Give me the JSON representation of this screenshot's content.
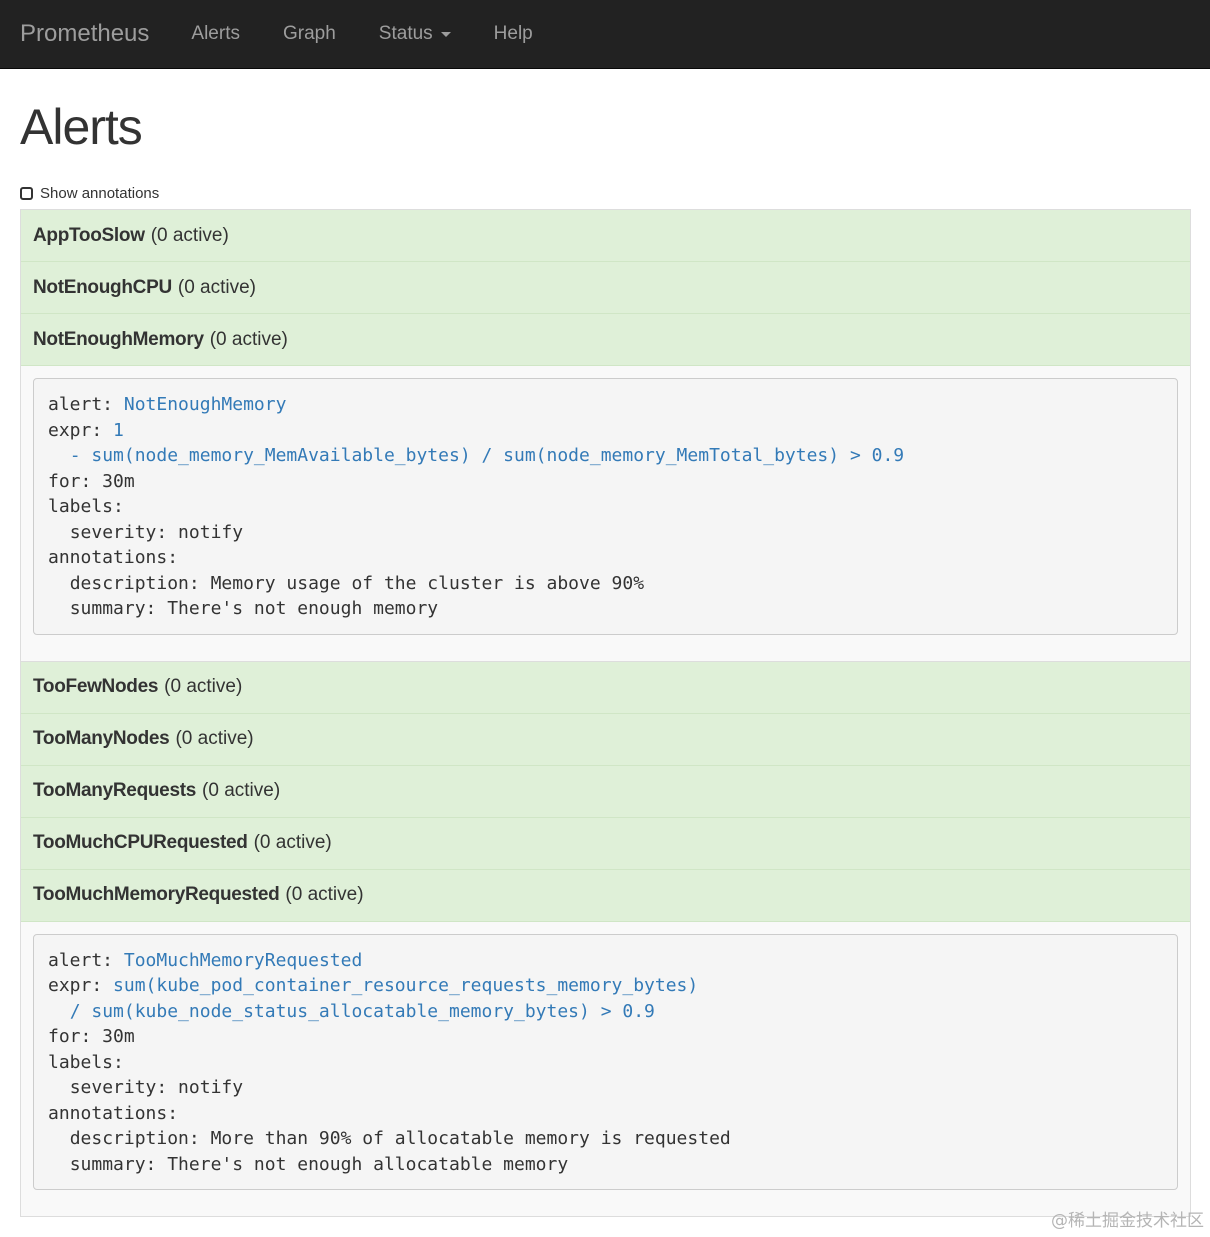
{
  "navbar": {
    "brand": "Prometheus",
    "items": [
      "Alerts",
      "Graph",
      "Status",
      "Help"
    ]
  },
  "page": {
    "title": "Alerts",
    "show_annotations_label": "Show annotations"
  },
  "alerts": [
    {
      "name": "AppTooSlow",
      "status": "(0 active)"
    },
    {
      "name": "NotEnoughCPU",
      "status": "(0 active)"
    },
    {
      "name": "NotEnoughMemory",
      "status": "(0 active)"
    },
    {
      "name": "TooFewNodes",
      "status": "(0 active)"
    },
    {
      "name": "TooManyNodes",
      "status": "(0 active)"
    },
    {
      "name": "TooManyRequests",
      "status": "(0 active)"
    },
    {
      "name": "TooMuchCPURequested",
      "status": "(0 active)"
    },
    {
      "name": "TooMuchMemoryRequested",
      "status": "(0 active)"
    }
  ],
  "rules": {
    "memory": {
      "alert_key": "alert:",
      "alert_value": "NotEnoughMemory",
      "expr_key": "expr:",
      "expr_line1": "1",
      "expr_line2": "- sum(node_memory_MemAvailable_bytes) / sum(node_memory_MemTotal_bytes) > 0.9",
      "for_line": "for: 30m",
      "labels_line": "labels:",
      "severity_line": "severity: notify",
      "annotations_line": "annotations:",
      "description_line": "description: Memory usage of the cluster is above 90%",
      "summary_line": "summary: There's not enough memory"
    },
    "memory_requested": {
      "alert_key": "alert:",
      "alert_value": "TooMuchMemoryRequested",
      "expr_key": "expr:",
      "expr_line1": "sum(kube_pod_container_resource_requests_memory_bytes)",
      "expr_line2": "/ sum(kube_node_status_allocatable_memory_bytes) > 0.9",
      "for_line": "for: 30m",
      "labels_line": "labels:",
      "severity_line": "severity: notify",
      "annotations_line": "annotations:",
      "description_line": "description: More than 90% of allocatable memory is requested",
      "summary_line": "summary: There's not enough allocatable memory"
    }
  },
  "watermark": "@稀土掘金技术社区"
}
